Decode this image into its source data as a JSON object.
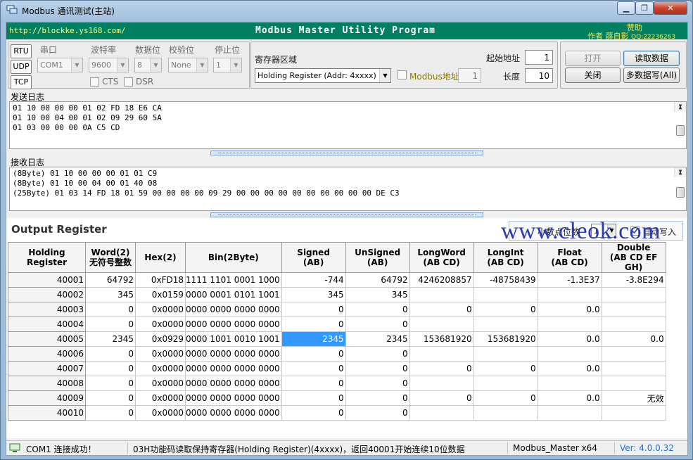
{
  "window": {
    "title": "Modbus 通讯测试(主站)",
    "minimize": "▁",
    "maximize": "❐",
    "close": "✕"
  },
  "banner": {
    "url": "http://blockke.ys168.com/",
    "program": "Modbus Master Utility Program",
    "donate": "赞助",
    "author": "作者 薛自影",
    "qq": "QQ:22236263"
  },
  "connection": {
    "modes": [
      "RTU",
      "UDP",
      "TCP"
    ],
    "port_label": "串口",
    "port_value": "COM1",
    "baud_label": "波特率",
    "baud_value": "9600",
    "databits_label": "数据位",
    "databits_value": "8",
    "parity_label": "校验位",
    "parity_value": "None",
    "stopbits_label": "停止位",
    "stopbits_value": "1",
    "cts_label": "CTS",
    "dsr_label": "DSR"
  },
  "register": {
    "area_label": "寄存器区域",
    "area_value": "Holding Register (Addr: 4xxxx)",
    "modbus_addr_label": "Modbus地址",
    "modbus_addr_value": "1",
    "start_label": "起始地址",
    "start_value": "1",
    "length_label": "长度",
    "length_value": "10"
  },
  "actions": {
    "open": "打开",
    "close": "关闭",
    "read": "读取数据",
    "multi_write": "多数据写(All)"
  },
  "send_log": {
    "label": "发送日志",
    "lines": [
      "01 10 00 00 00 01 02 FD 18 E6 CA",
      "01 10 00 04 00 01 02 09 29 60 5A",
      "01 03 00 00 00 0A C5 CD"
    ]
  },
  "recv_log": {
    "label": "接收日志",
    "lines": [
      "(8Byte) 01 10 00 00 00 01 01 C9",
      "(8Byte) 01 10 00 04 00 01 40 08",
      "(25Byte) 01 03 14 FD 18 01 59 00 00 00 00 09 29 00 00 00 00 00 00 00 00 00 00 DE C3"
    ]
  },
  "output": {
    "title": "Output Register",
    "decimal_label": "小数点位数",
    "decimal_value": "1",
    "auto_write_label": "自动写入",
    "columns": [
      {
        "l1": "Holding Register",
        "l2": ""
      },
      {
        "l1": "Word(2)",
        "l2": "无符号整数"
      },
      {
        "l1": "Hex(2)",
        "l2": ""
      },
      {
        "l1": "Bin(2Byte)",
        "l2": ""
      },
      {
        "l1": "Signed",
        "l2": "(AB)"
      },
      {
        "l1": "UnSigned",
        "l2": "(AB)"
      },
      {
        "l1": "LongWord",
        "l2": "(AB CD)"
      },
      {
        "l1": "LongInt",
        "l2": "(AB CD)"
      },
      {
        "l1": "Float",
        "l2": "(AB CD)"
      },
      {
        "l1": "Double",
        "l2": "(AB CD EF GH)"
      }
    ],
    "rows": [
      [
        "40001",
        "64792",
        "0xFD18",
        "1111 1101 0001 1000",
        "-744",
        "64792",
        "4246208857",
        "-48758439",
        "-1.3E37",
        "-3.8E294"
      ],
      [
        "40002",
        "345",
        "0x0159",
        "0000 0001 0101 1001",
        "345",
        "345",
        "",
        "",
        "",
        ""
      ],
      [
        "40003",
        "0",
        "0x0000",
        "0000 0000 0000 0000",
        "0",
        "0",
        "0",
        "0",
        "0.0",
        ""
      ],
      [
        "40004",
        "0",
        "0x0000",
        "0000 0000 0000 0000",
        "0",
        "0",
        "",
        "",
        "",
        ""
      ],
      [
        "40005",
        "2345",
        "0x0929",
        "0000 1001 0010 1001",
        "2345",
        "2345",
        "153681920",
        "153681920",
        "0.0",
        "0.0"
      ],
      [
        "40006",
        "0",
        "0x0000",
        "0000 0000 0000 0000",
        "0",
        "0",
        "",
        "",
        "",
        ""
      ],
      [
        "40007",
        "0",
        "0x0000",
        "0000 0000 0000 0000",
        "0",
        "0",
        "0",
        "0",
        "0.0",
        ""
      ],
      [
        "40008",
        "0",
        "0x0000",
        "0000 0000 0000 0000",
        "0",
        "0",
        "",
        "",
        "",
        ""
      ],
      [
        "40009",
        "0",
        "0x0000",
        "0000 0000 0000 0000",
        "0",
        "0",
        "0",
        "0",
        "0.0",
        "无效"
      ],
      [
        "40010",
        "0",
        "0x0000",
        "0000 0000 0000 0000",
        "0",
        "0",
        "",
        "",
        "",
        ""
      ]
    ]
  },
  "status": {
    "connection": "COM1 连接成功！",
    "message": "03H功能码读取保持寄存器(Holding Register)(4xxxx)，返回40001开始连续10位数据",
    "app": "Modbus_Master x64",
    "version": "Ver: 4.0.0.32"
  },
  "watermark": "www.cleok.com",
  "colors": {
    "banner": "#008060",
    "selection": "#3399ff",
    "version": "#1c6fd8"
  }
}
